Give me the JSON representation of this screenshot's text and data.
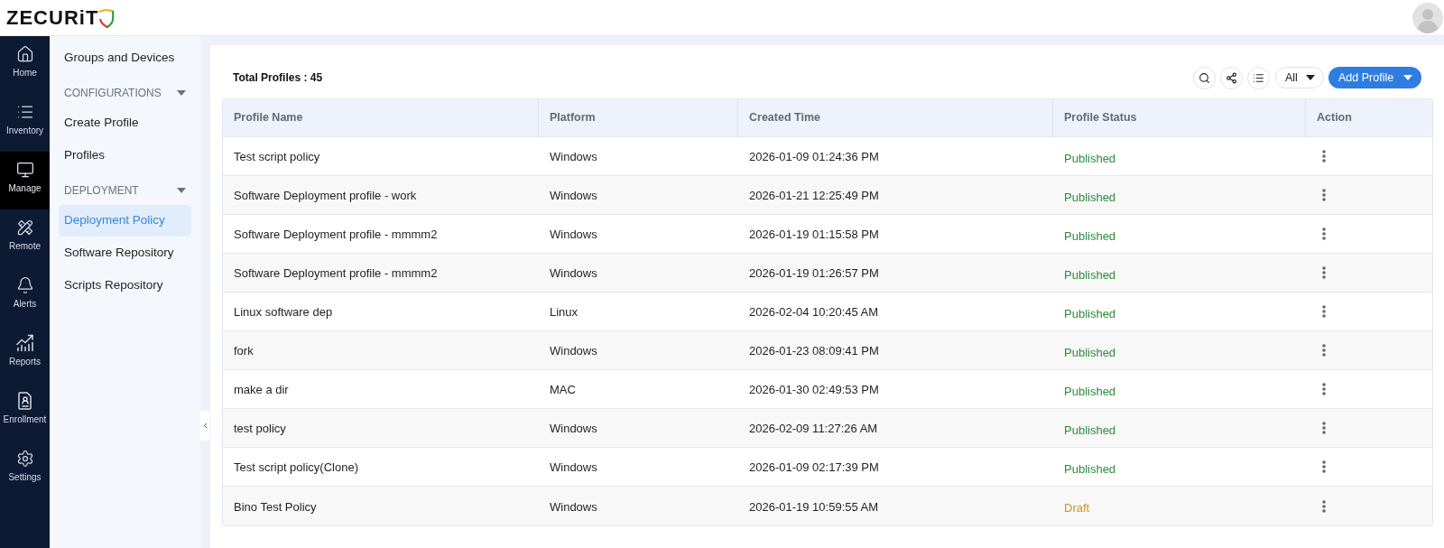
{
  "header": {
    "logo": "ZECURiT"
  },
  "rail": [
    {
      "label": "Home",
      "selected": false
    },
    {
      "label": "Inventory",
      "selected": false
    },
    {
      "label": "Manage",
      "selected": true
    },
    {
      "label": "Remote",
      "selected": false
    },
    {
      "label": "Alerts",
      "selected": false
    },
    {
      "label": "Reports",
      "selected": false
    },
    {
      "label": "Enrollment",
      "selected": false
    },
    {
      "label": "Settings",
      "selected": false
    }
  ],
  "sidebar": {
    "items": [
      {
        "kind": "link",
        "label": "Groups and Devices",
        "selected": false
      },
      {
        "kind": "section",
        "label": "CONFIGURATIONS",
        "expanded": true,
        "children": [
          {
            "label": "Create Profile",
            "selected": false
          },
          {
            "label": "Profiles",
            "selected": false
          }
        ]
      },
      {
        "kind": "section",
        "label": "DEPLOYMENT",
        "expanded": true,
        "children": [
          {
            "label": "Deployment Policy",
            "selected": true
          },
          {
            "label": "Software Repository",
            "selected": false
          },
          {
            "label": "Scripts Repository",
            "selected": false
          }
        ]
      }
    ]
  },
  "toolbar": {
    "total": "Total Profiles : 45",
    "filter": {
      "value": "All"
    },
    "add_button": {
      "label": "Add Profile"
    }
  },
  "table": {
    "columns": [
      "Profile Name",
      "Platform",
      "Created Time",
      "Profile Status",
      "Action"
    ],
    "rows": [
      {
        "name": "Test script policy",
        "platform": "Windows",
        "created": "2026-01-09 01:24:36 PM",
        "status": {
          "text": "Published",
          "color": "#2e8b3a"
        }
      },
      {
        "name": "Software Deployment profile - work",
        "platform": "Windows",
        "created": "2026-01-21 12:25:49 PM",
        "status": {
          "text": "Published",
          "color": "#2e8b3a"
        }
      },
      {
        "name": "Software Deployment profile - mmmm2",
        "platform": "Windows",
        "created": "2026-01-19 01:15:58 PM",
        "status": {
          "text": "Published",
          "color": "#2e8b3a"
        }
      },
      {
        "name": "Software Deployment profile - mmmm2",
        "platform": "Windows",
        "created": "2026-01-19 01:26:57 PM",
        "status": {
          "text": "Published",
          "color": "#2e8b3a"
        }
      },
      {
        "name": "Linux software dep",
        "platform": "Linux",
        "created": "2026-02-04 10:20:45 AM",
        "status": {
          "text": "Published",
          "color": "#2e8b3a"
        }
      },
      {
        "name": "fork",
        "platform": "Windows",
        "created": "2026-01-23 08:09:41 PM",
        "status": {
          "text": "Published",
          "color": "#2e8b3a"
        }
      },
      {
        "name": "make a dir",
        "platform": "MAC",
        "created": "2026-01-30 02:49:53 PM",
        "status": {
          "text": "Published",
          "color": "#2e8b3a"
        }
      },
      {
        "name": "test policy",
        "platform": "Windows",
        "created": "2026-02-09 11:27:26 AM",
        "status": {
          "text": "Published",
          "color": "#2e8b3a"
        }
      },
      {
        "name": "Test script policy(Clone)",
        "platform": "Windows",
        "created": "2026-01-09 02:17:39 PM",
        "status": {
          "text": "Published",
          "color": "#2e8b3a"
        }
      },
      {
        "name": "Bino Test Policy",
        "platform": "Windows",
        "created": "2026-01-19 10:59:55 AM",
        "status": {
          "text": "Draft",
          "color": "#c9972e"
        }
      }
    ]
  }
}
